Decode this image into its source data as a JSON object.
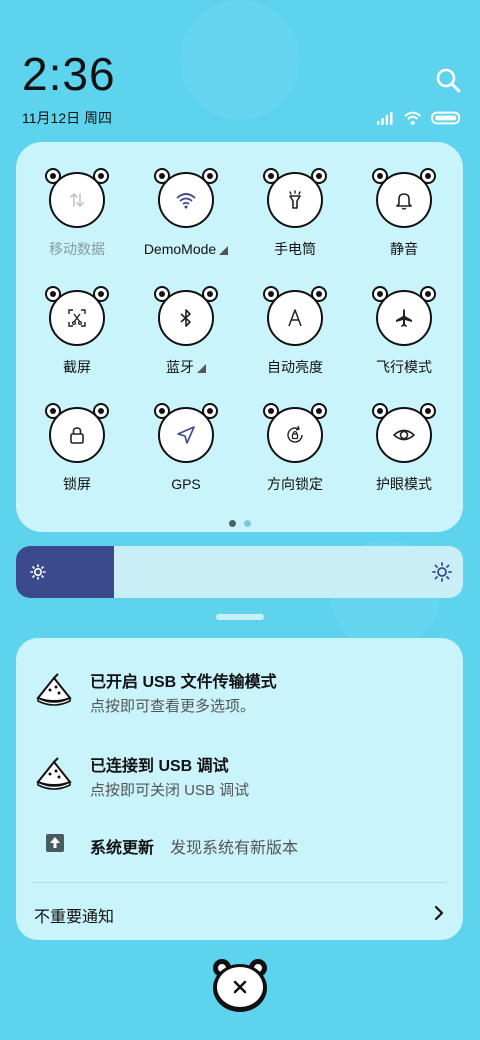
{
  "status": {
    "time": "2:36",
    "date": "11月12日 周四"
  },
  "tiles": [
    {
      "label": "移动数据",
      "icon": "mobile-data-icon",
      "dim": true
    },
    {
      "label": "DemoMode",
      "icon": "wifi-icon",
      "arrow": true
    },
    {
      "label": "手电筒",
      "icon": "flashlight-icon"
    },
    {
      "label": "静音",
      "icon": "bell-icon"
    },
    {
      "label": "截屏",
      "icon": "screenshot-icon"
    },
    {
      "label": "蓝牙",
      "icon": "bluetooth-icon",
      "arrow": true
    },
    {
      "label": "自动亮度",
      "icon": "auto-brightness-icon"
    },
    {
      "label": "飞行模式",
      "icon": "airplane-icon"
    },
    {
      "label": "锁屏",
      "icon": "lock-icon"
    },
    {
      "label": "GPS",
      "icon": "location-arrow-icon"
    },
    {
      "label": "方向锁定",
      "icon": "rotation-lock-icon"
    },
    {
      "label": "护眼模式",
      "icon": "eye-icon"
    }
  ],
  "pager": {
    "pages": 2,
    "current": 1
  },
  "brightness": {
    "level": 0.22,
    "fill_color": "#3a4a8c"
  },
  "notifications": [
    {
      "title": "已开启 USB 文件传输模式",
      "text": "点按即可查看更多选项。",
      "icon": "watermelon-icon"
    },
    {
      "title": "已连接到 USB 调试",
      "text": "点按即可关闭 USB 调试",
      "icon": "watermelon-icon"
    },
    {
      "title": "系统更新",
      "text": "发现系统有新版本",
      "icon": "upload-arrow-icon"
    }
  ],
  "unimportant_label": "不重要通知",
  "colors": {
    "background": "#5dd3ee",
    "panel": "#c9f4fb",
    "accent": "#3a4a8c"
  }
}
